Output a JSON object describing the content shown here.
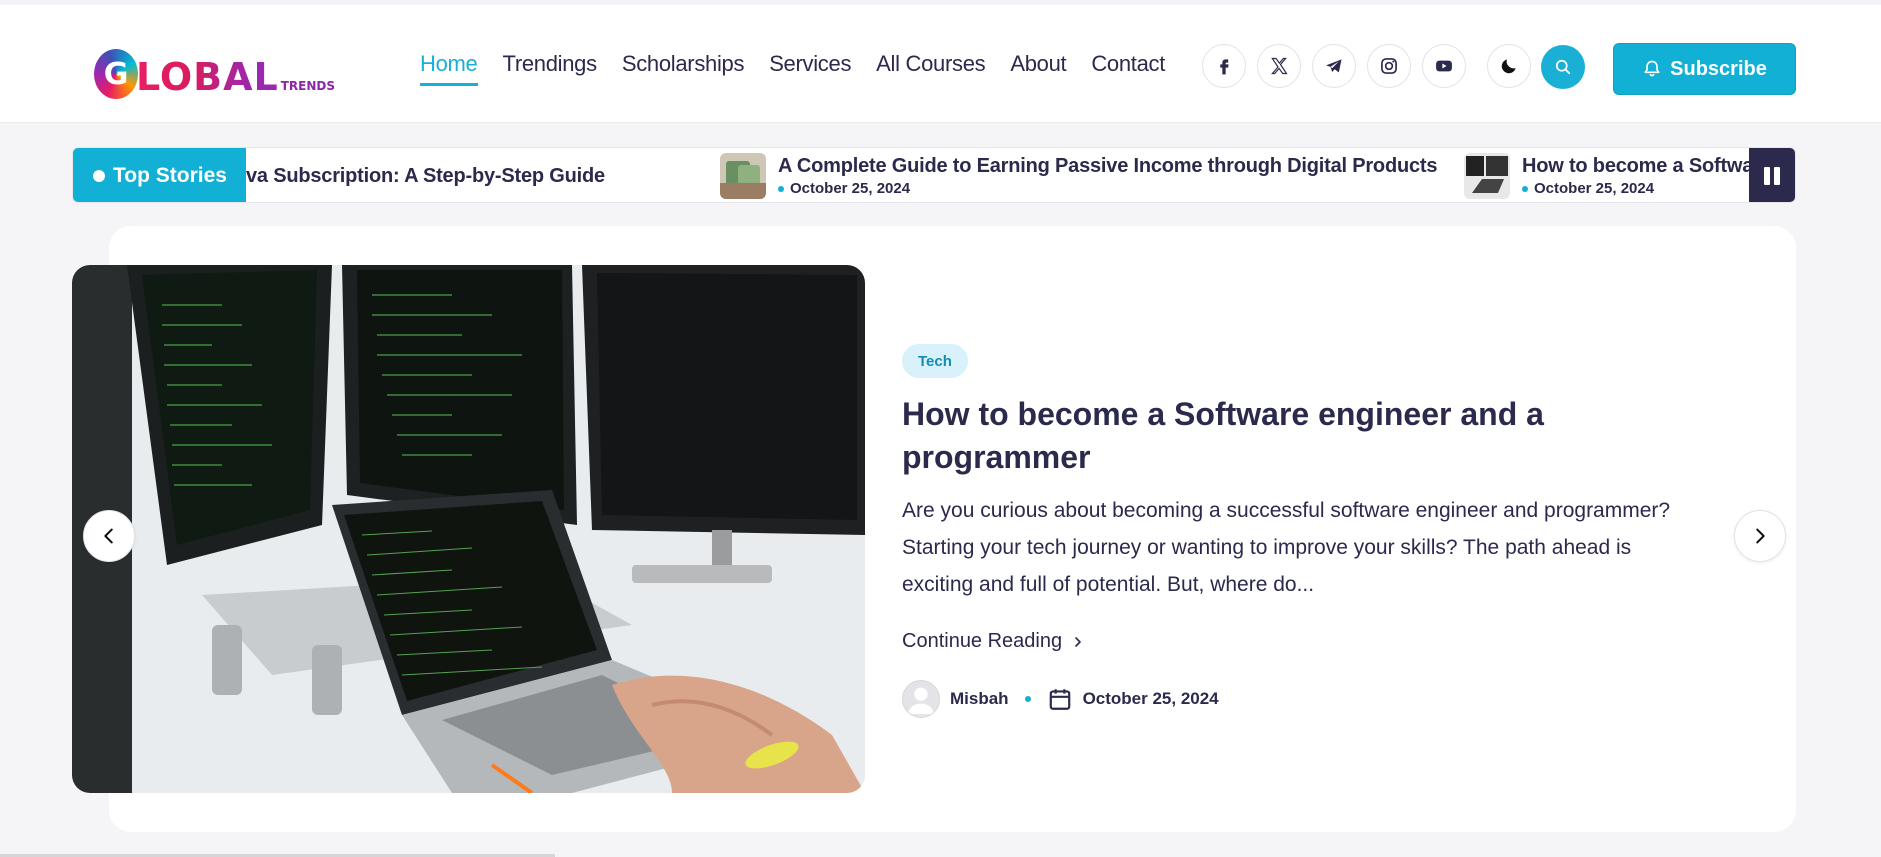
{
  "header": {
    "logo": {
      "letter": "G",
      "text": "LOBAL",
      "sub": "TRENDS"
    },
    "nav": [
      {
        "label": "Home",
        "active": true
      },
      {
        "label": "Trendings"
      },
      {
        "label": "Scholarships"
      },
      {
        "label": "Services"
      },
      {
        "label": "All Courses"
      },
      {
        "label": "About"
      },
      {
        "label": "Contact"
      }
    ],
    "social_icons": [
      "facebook-icon",
      "x-twitter-icon",
      "telegram-icon",
      "instagram-icon",
      "youtube-icon"
    ],
    "theme_icon": "moon-icon",
    "search_icon": "search-icon",
    "subscribe_label": "Subscribe"
  },
  "ticker": {
    "label": "Top Stories",
    "items": [
      {
        "title": "va Subscription: A Step-by-Step Guide",
        "date": ""
      },
      {
        "title": "A Complete Guide to Earning Passive Income through Digital Products",
        "date": "October 25, 2024"
      },
      {
        "title": "How to become a Software engi",
        "date": "October 25, 2024"
      }
    ]
  },
  "hero": {
    "tag": "Tech",
    "title": "How to become a Software engineer and a programmer",
    "excerpt": "Are you curious about becoming a successful software engineer and programmer? Starting your tech journey or wanting to improve your skills? The path ahead is exciting and full of potential. But, where do...",
    "continue_label": "Continue Reading",
    "author": "Misbah",
    "date": "October 25, 2024"
  },
  "colors": {
    "accent": "#12b0d4",
    "text": "#2b2a4c",
    "tag_bg": "#d8f1fb",
    "brand_pink": "#e91e63"
  }
}
